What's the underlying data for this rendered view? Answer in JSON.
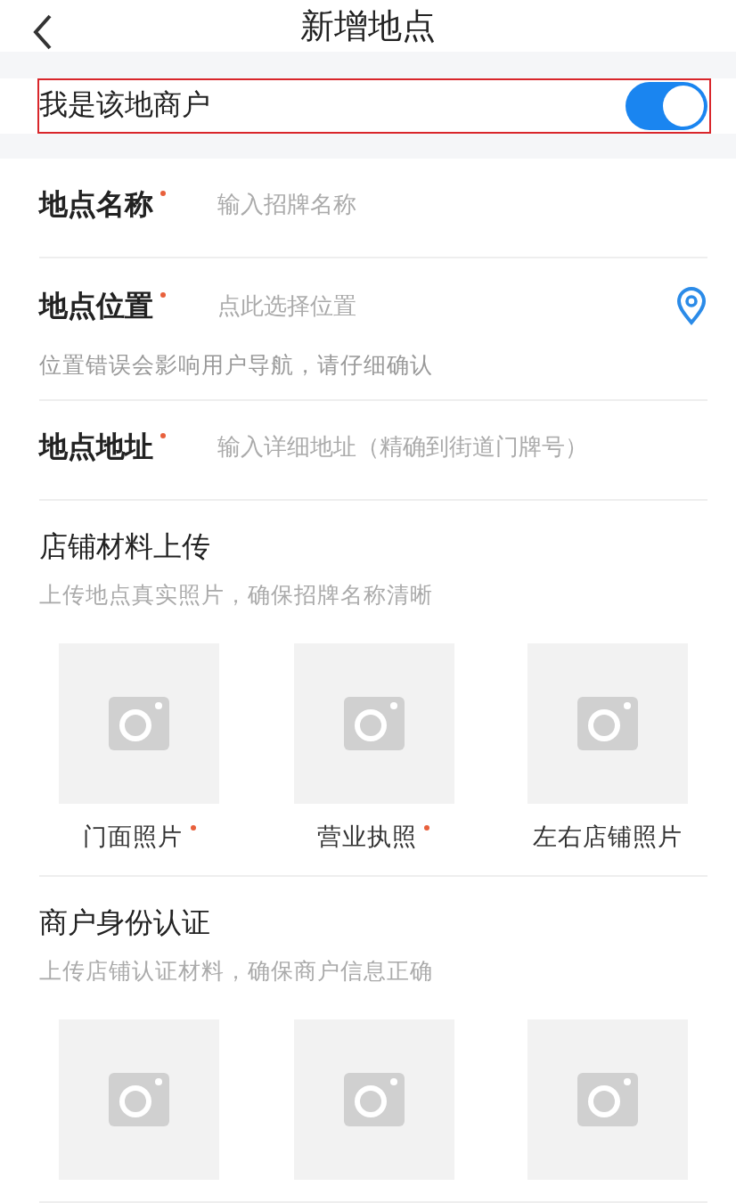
{
  "header": {
    "title": "新增地点"
  },
  "merchant_toggle": {
    "label": "我是该地商户",
    "on": true,
    "highlighted": true
  },
  "fields": [
    {
      "kind": "text",
      "label": "地点名称",
      "required": true,
      "placeholder": "输入招牌名称"
    },
    {
      "kind": "location",
      "label": "地点位置",
      "required": true,
      "placeholder": "点此选择位置",
      "hint": "位置错误会影响用户导航，请仔细确认"
    },
    {
      "kind": "text",
      "label": "地点地址",
      "required": true,
      "placeholder": "输入详细地址（精确到街道门牌号）"
    }
  ],
  "sections": [
    {
      "title": "店铺材料上传",
      "subtitle": "上传地点真实照片，确保招牌名称清晰",
      "uploads": [
        {
          "kind": "photo",
          "label": "门面照片",
          "required": true
        },
        {
          "kind": "photo",
          "label": "营业执照",
          "required": true
        },
        {
          "kind": "photo",
          "label": "左右店铺照片",
          "required": false
        }
      ]
    },
    {
      "title": "商户身份认证",
      "subtitle": "上传店铺认证材料，确保商户信息正确",
      "uploads": [
        {
          "kind": "photo"
        },
        {
          "kind": "photo"
        },
        {
          "kind": "photo"
        }
      ]
    }
  ]
}
